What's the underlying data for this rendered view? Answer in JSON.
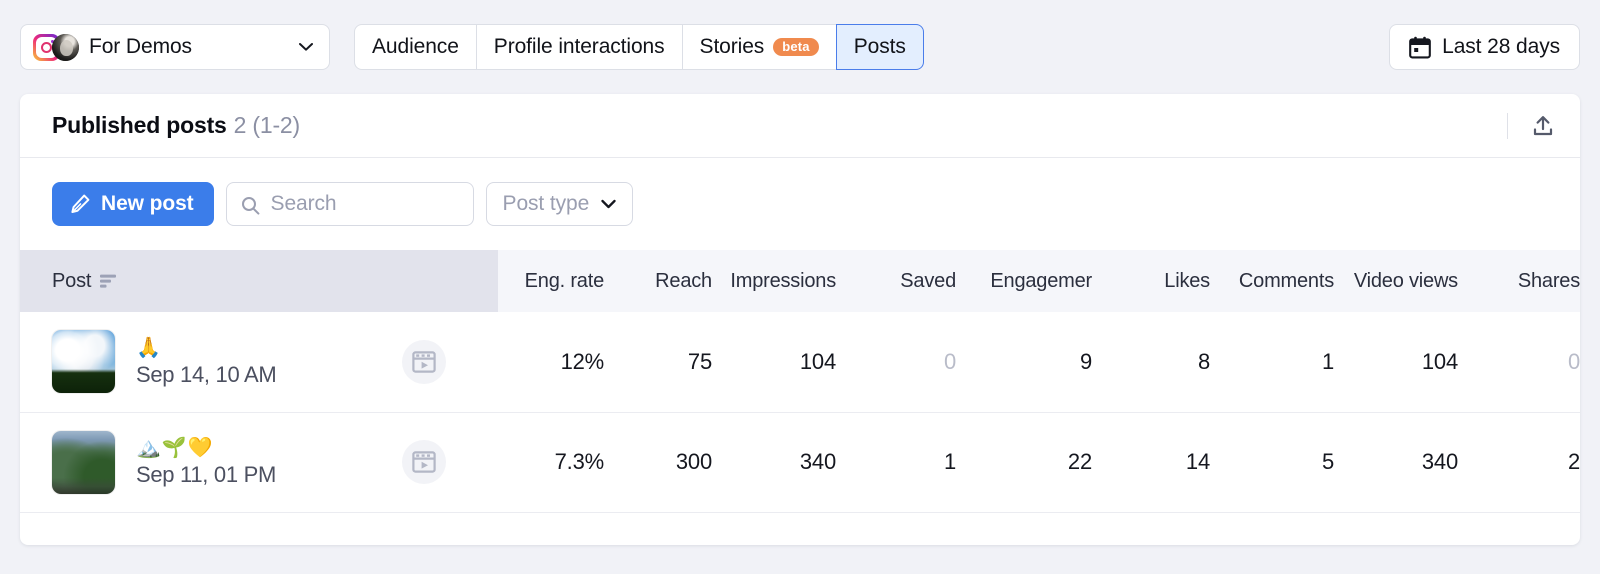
{
  "topbar": {
    "account": {
      "name": "For Demos",
      "icon": "instagram-icon"
    },
    "tabs": [
      {
        "label": "Audience",
        "active": false
      },
      {
        "label": "Profile interactions",
        "active": false
      },
      {
        "label": "Stories",
        "active": false,
        "badge": "beta"
      },
      {
        "label": "Posts",
        "active": true
      }
    ],
    "date_range": {
      "label": "Last 28 days",
      "icon": "calendar-icon"
    }
  },
  "card": {
    "title": "Published posts",
    "count": "2 (1-2)",
    "export_icon": "export-icon"
  },
  "toolbar": {
    "new_post_label": "New post",
    "new_post_icon": "pencil-icon",
    "search_placeholder": "Search",
    "search_value": "",
    "search_icon": "search-icon",
    "post_type_label": "Post type",
    "post_type_icon": "chevron-down-icon"
  },
  "table": {
    "columns": [
      {
        "key": "post",
        "label": "Post",
        "sorted": true,
        "sort_icon": "sort-descending-icon"
      },
      {
        "key": "eng_rate",
        "label": "Eng. rate"
      },
      {
        "key": "reach",
        "label": "Reach"
      },
      {
        "key": "impressions",
        "label": "Impressions"
      },
      {
        "key": "saved",
        "label": "Saved"
      },
      {
        "key": "engagement",
        "label": "Engagemer"
      },
      {
        "key": "likes",
        "label": "Likes"
      },
      {
        "key": "comments",
        "label": "Comments"
      },
      {
        "key": "video_views",
        "label": "Video views"
      },
      {
        "key": "shares",
        "label": "Shares"
      }
    ],
    "rows": [
      {
        "emoji": "🙏",
        "date": "Sep 14, 10 AM",
        "type_icon": "reel-icon",
        "eng_rate": "12%",
        "reach": "75",
        "impressions": "104",
        "saved": "0",
        "saved_zero": true,
        "engagement": "9",
        "likes": "8",
        "comments": "1",
        "video_views": "104",
        "shares": "0",
        "shares_zero": true
      },
      {
        "emoji": "🏔️🌱💛",
        "date": "Sep 11, 01 PM",
        "type_icon": "reel-icon",
        "eng_rate": "7.3%",
        "reach": "300",
        "impressions": "340",
        "saved": "1",
        "saved_zero": false,
        "engagement": "22",
        "likes": "14",
        "comments": "5",
        "video_views": "340",
        "shares": "2",
        "shares_zero": false
      }
    ]
  },
  "colors": {
    "accent_blue": "#3b7dea",
    "active_tab_bg": "#e3eefe",
    "beta_badge": "#f08a4e",
    "page_bg": "#f1f2f7",
    "header_bg": "#f5f6fa",
    "sorted_header_bg": "#e2e3ec",
    "muted_text": "#b9bcc9"
  }
}
